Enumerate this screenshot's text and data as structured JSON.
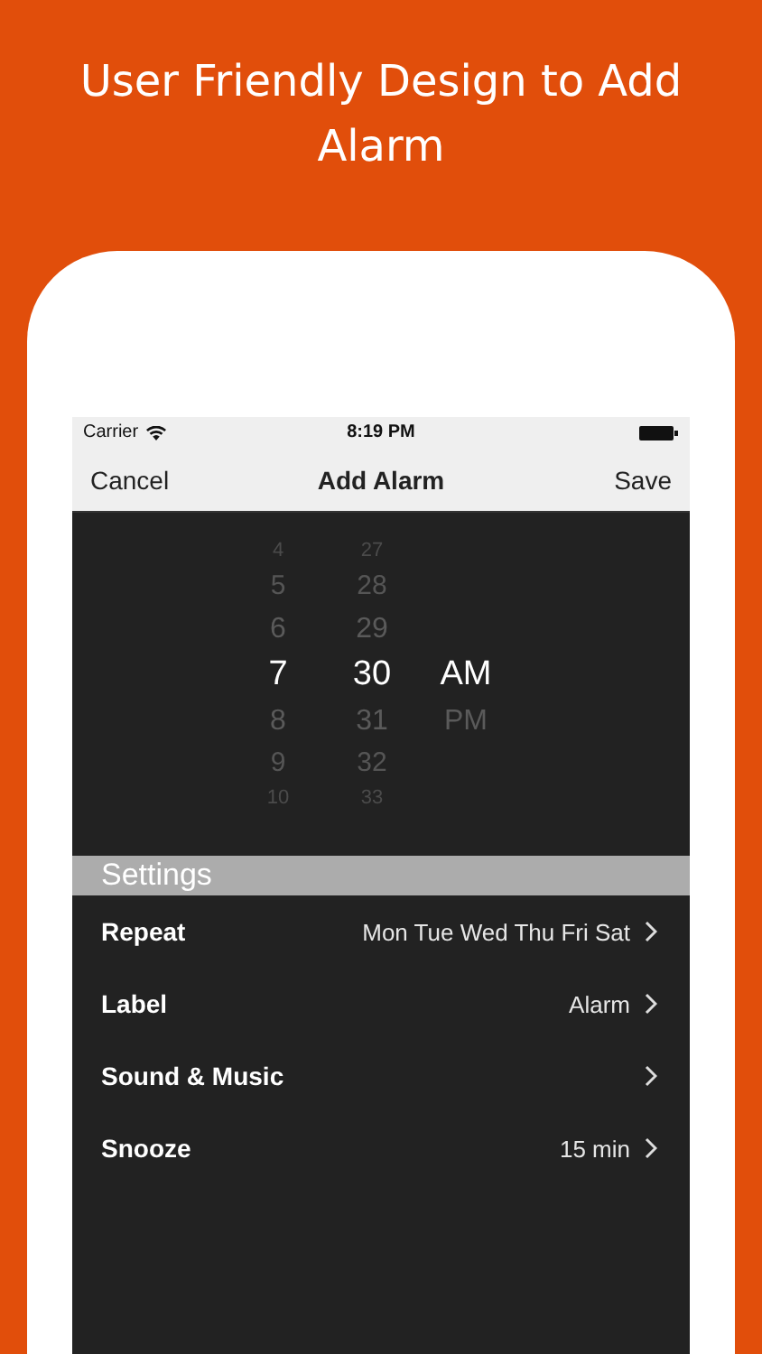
{
  "headline": "User Friendly Design to Add Alarm",
  "status_bar": {
    "carrier": "Carrier",
    "time": "8:19 PM"
  },
  "nav_bar": {
    "left": "Cancel",
    "title": "Add Alarm",
    "right": "Save"
  },
  "picker": {
    "columns": [
      {
        "items": [
          {
            "label": "4",
            "selected": false
          },
          {
            "label": "5",
            "selected": false
          },
          {
            "label": "6",
            "selected": false
          },
          {
            "label": "7",
            "selected": true
          },
          {
            "label": "8",
            "selected": false
          },
          {
            "label": "9",
            "selected": false
          },
          {
            "label": "10",
            "selected": false
          }
        ]
      },
      {
        "items": [
          {
            "label": "27",
            "selected": false
          },
          {
            "label": "28",
            "selected": false
          },
          {
            "label": "29",
            "selected": false
          },
          {
            "label": "30",
            "selected": true
          },
          {
            "label": "31",
            "selected": false
          },
          {
            "label": "32",
            "selected": false
          },
          {
            "label": "33",
            "selected": false
          }
        ]
      },
      {
        "items": [
          {
            "label": "AM",
            "selected": true
          },
          {
            "label": "PM",
            "selected": false
          }
        ]
      }
    ]
  },
  "settings": {
    "header": "Settings",
    "rows": [
      {
        "label": "Repeat",
        "value": "Mon Tue Wed Thu Fri Sat"
      },
      {
        "label": "Label",
        "value": "Alarm"
      },
      {
        "label": "Sound & Music"
      },
      {
        "label": "Snooze",
        "value": "15 min"
      }
    ]
  }
}
